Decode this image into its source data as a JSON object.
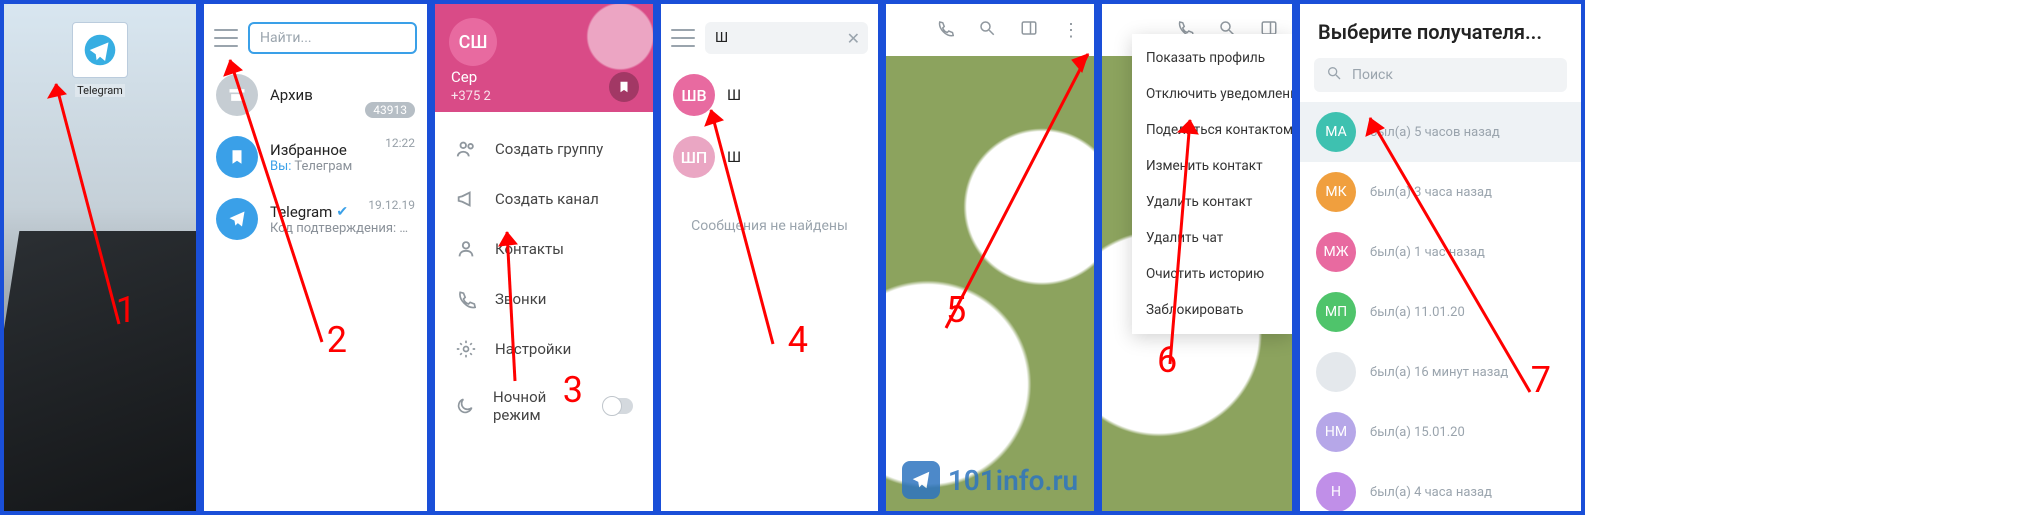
{
  "step_labels": [
    "1",
    "2",
    "3",
    "4",
    "5",
    "6",
    "7"
  ],
  "panel1": {
    "app_name": "Telegram"
  },
  "panel2": {
    "search_placeholder": "Найти...",
    "archive_label": "Архив",
    "archive_count": "43913",
    "saved_title": "Избранное",
    "saved_time": "12:22",
    "saved_sub_prefix": "Вы: ",
    "saved_sub": "Телеграм",
    "tg_title": "Telegram",
    "tg_time": "19.12.19",
    "tg_sub": "Код подтверждения: 1…"
  },
  "panel3": {
    "avatar_initials": "СШ",
    "name": "Сер",
    "phone": "+375 2",
    "menu": {
      "group": "Создать группу",
      "channel": "Создать канал",
      "contacts": "Контакты",
      "calls": "Звонки",
      "settings": "Настройки",
      "night": "Ночной режим"
    }
  },
  "panel4": {
    "query": "Ш",
    "r1_initials": "ШВ",
    "r1_name": "Ш",
    "r2_initials": "ШП",
    "r2_name": "Ш",
    "no_results": "Сообщения не найдены"
  },
  "panel5": {
    "watermark_text": "101info.ru"
  },
  "panel6": {
    "items": {
      "profile": "Показать профиль",
      "mute": "Отключить уведомления",
      "share": "Поделиться контактом",
      "edit": "Изменить контакт",
      "delcontact": "Удалить контакт",
      "delchat": "Удалить чат",
      "clear": "Очистить историю",
      "block": "Заблокировать"
    }
  },
  "panel7": {
    "title": "Выберите получателя...",
    "search_placeholder": "Поиск",
    "contacts": [
      {
        "initials": "МА",
        "status": "был(а) 5 часов назад"
      },
      {
        "initials": "МК",
        "status": "был(а) 3 часа назад"
      },
      {
        "initials": "МЖ",
        "status": "был(а) 1 час назад"
      },
      {
        "initials": "МП",
        "status": "был(а) 11.01.20"
      },
      {
        "initials": "",
        "status": "был(а) 16 минут назад"
      },
      {
        "initials": "НМ",
        "status": "был(а) 15.01.20"
      },
      {
        "initials": "Н",
        "status": "был(а) 4 часа назад"
      }
    ]
  }
}
